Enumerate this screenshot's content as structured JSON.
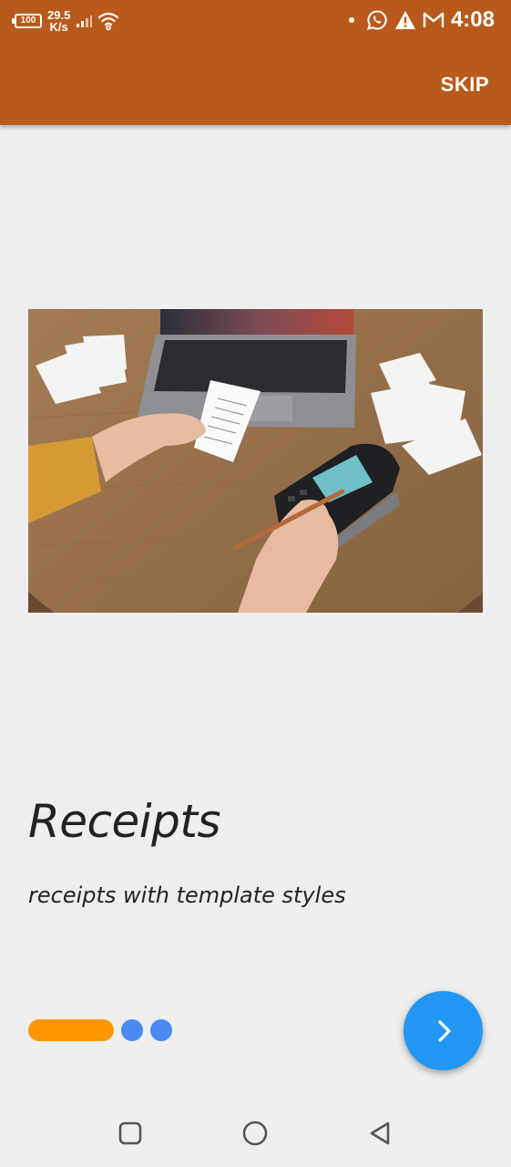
{
  "status_bar": {
    "battery": "100",
    "net_speed_value": "29.5",
    "net_speed_unit": "K/s",
    "time": "4:08",
    "icons": [
      "signal-icon",
      "wifi-icon",
      "whatsapp-icon",
      "warning-icon",
      "gmail-icon"
    ]
  },
  "appbar": {
    "skip_label": "SKIP",
    "color": "#b95a1c"
  },
  "slide": {
    "image": "receipts-payment-terminal-photo",
    "title": "Receipts",
    "subtitle": "receipts with template styles"
  },
  "pager": {
    "total": 3,
    "current": 1,
    "active_color": "#ff9800",
    "inactive_color": "#4a8af4"
  },
  "fab": {
    "icon": "chevron-right-icon",
    "color": "#2196f3"
  },
  "nav": {
    "icons": [
      "recent-apps-icon",
      "home-icon",
      "back-icon"
    ]
  }
}
